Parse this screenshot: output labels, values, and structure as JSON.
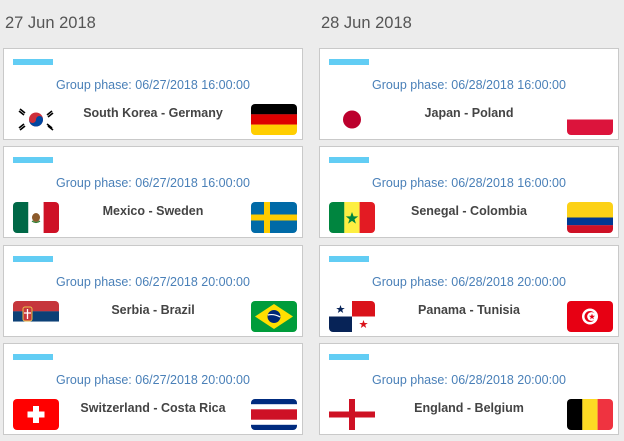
{
  "columns": [
    {
      "date": "27 Jun 2018",
      "matches": [
        {
          "phase": "Group phase: 06/27/2018 16:00:00",
          "teams": "South Korea - Germany",
          "home_flag": "south-korea-flag-icon",
          "away_flag": "germany-flag-icon"
        },
        {
          "phase": "Group phase: 06/27/2018 16:00:00",
          "teams": "Mexico - Sweden",
          "home_flag": "mexico-flag-icon",
          "away_flag": "sweden-flag-icon"
        },
        {
          "phase": "Group phase: 06/27/2018 20:00:00",
          "teams": "Serbia - Brazil",
          "home_flag": "serbia-flag-icon",
          "away_flag": "brazil-flag-icon"
        },
        {
          "phase": "Group phase: 06/27/2018 20:00:00",
          "teams": "Switzerland - Costa Rica",
          "home_flag": "switzerland-flag-icon",
          "away_flag": "costa-rica-flag-icon"
        }
      ]
    },
    {
      "date": "28 Jun 2018",
      "matches": [
        {
          "phase": "Group phase: 06/28/2018 16:00:00",
          "teams": "Japan - Poland",
          "home_flag": "japan-flag-icon",
          "away_flag": "poland-flag-icon"
        },
        {
          "phase": "Group phase: 06/28/2018 16:00:00",
          "teams": "Senegal - Colombia",
          "home_flag": "senegal-flag-icon",
          "away_flag": "colombia-flag-icon"
        },
        {
          "phase": "Group phase: 06/28/2018 20:00:00",
          "teams": "Panama - Tunisia",
          "home_flag": "panama-flag-icon",
          "away_flag": "tunisia-flag-icon"
        },
        {
          "phase": "Group phase: 06/28/2018 20:00:00",
          "teams": "England - Belgium",
          "home_flag": "england-flag-icon",
          "away_flag": "belgium-flag-icon"
        }
      ]
    }
  ],
  "colors": {
    "accent_bar": "#62cdf4",
    "phase_text": "#4a80b8",
    "team_text": "#444444",
    "page_bg": "#ececec"
  }
}
